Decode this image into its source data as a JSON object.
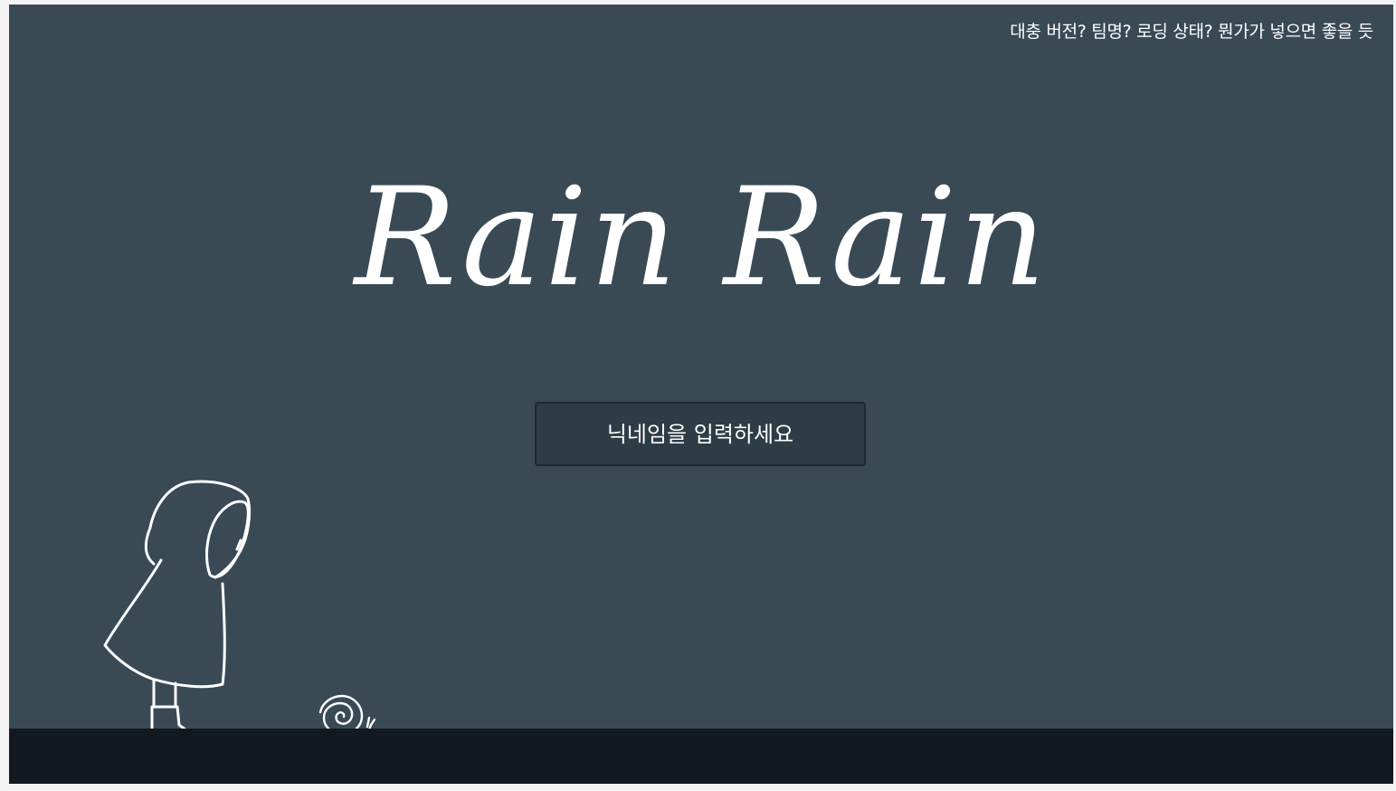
{
  "header": {
    "note": "대충 버전? 팀명? 로딩 상태? 뭔가가 넣으면 좋을 듯"
  },
  "title": {
    "text": "Rain Rain"
  },
  "nickname": {
    "placeholder": "닉네임을 입력하세요",
    "value": ""
  },
  "colors": {
    "background": "#394a55",
    "ground": "#121920",
    "input_bg": "#2e3c45",
    "stroke": "#ffffff"
  },
  "icons": {
    "character": "raincoat-child-icon",
    "snail": "snail-icon"
  }
}
